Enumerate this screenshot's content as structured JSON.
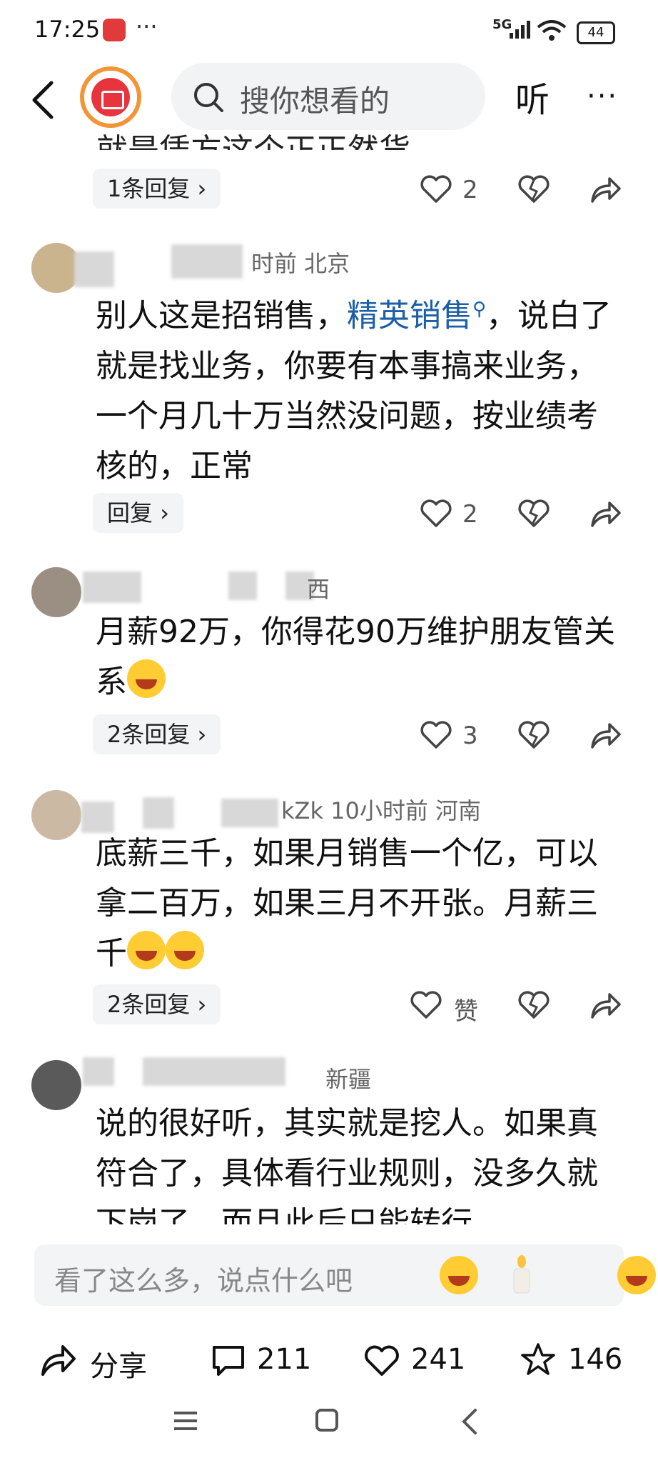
{
  "status_bar": {
    "time": "17:25",
    "dots": "···",
    "network": "5G",
    "battery": "44"
  },
  "nav": {
    "search_placeholder": "搜你想看的",
    "listen_label": "听",
    "more_label": "···"
  },
  "comments": [
    {
      "cut_text": "就是凭方这个正正然货",
      "reply_label": "1条回复",
      "likes": "2"
    },
    {
      "meta": "时前  北京",
      "text_before": "别人这是招销售，",
      "link": "精英销售",
      "text_after": "，说白了就是找业务，你要有本事搞来业务，一个月几十万当然没问题，按业绩考核的，正常",
      "reply_label": "回复",
      "likes": "2"
    },
    {
      "meta": "西",
      "text": "月薪92万，你得花90万维护朋友管关系",
      "reply_label": "2条回复",
      "likes": "3"
    },
    {
      "meta": "kZk  10小时前  河南",
      "text": "底薪三千，如果月销售一个亿，可以拿二百万，如果三月不开张。月薪三千",
      "reply_label": "2条回复",
      "likes": "赞"
    },
    {
      "meta": "新疆",
      "text": "说的很好听，其实就是挖人。如果真符合了，具体看行业规则，没多久就下岗了，而且此后只能转行"
    }
  ],
  "comment_input": {
    "placeholder": "看了这么多，说点什么吧"
  },
  "bottom_bar": {
    "share_label": "分享",
    "comments_count": "211",
    "likes_count": "241",
    "favorites_count": "146"
  },
  "colors": {
    "link": "#1b5fa8",
    "accent": "#e8353d",
    "ring": "#f39436"
  }
}
